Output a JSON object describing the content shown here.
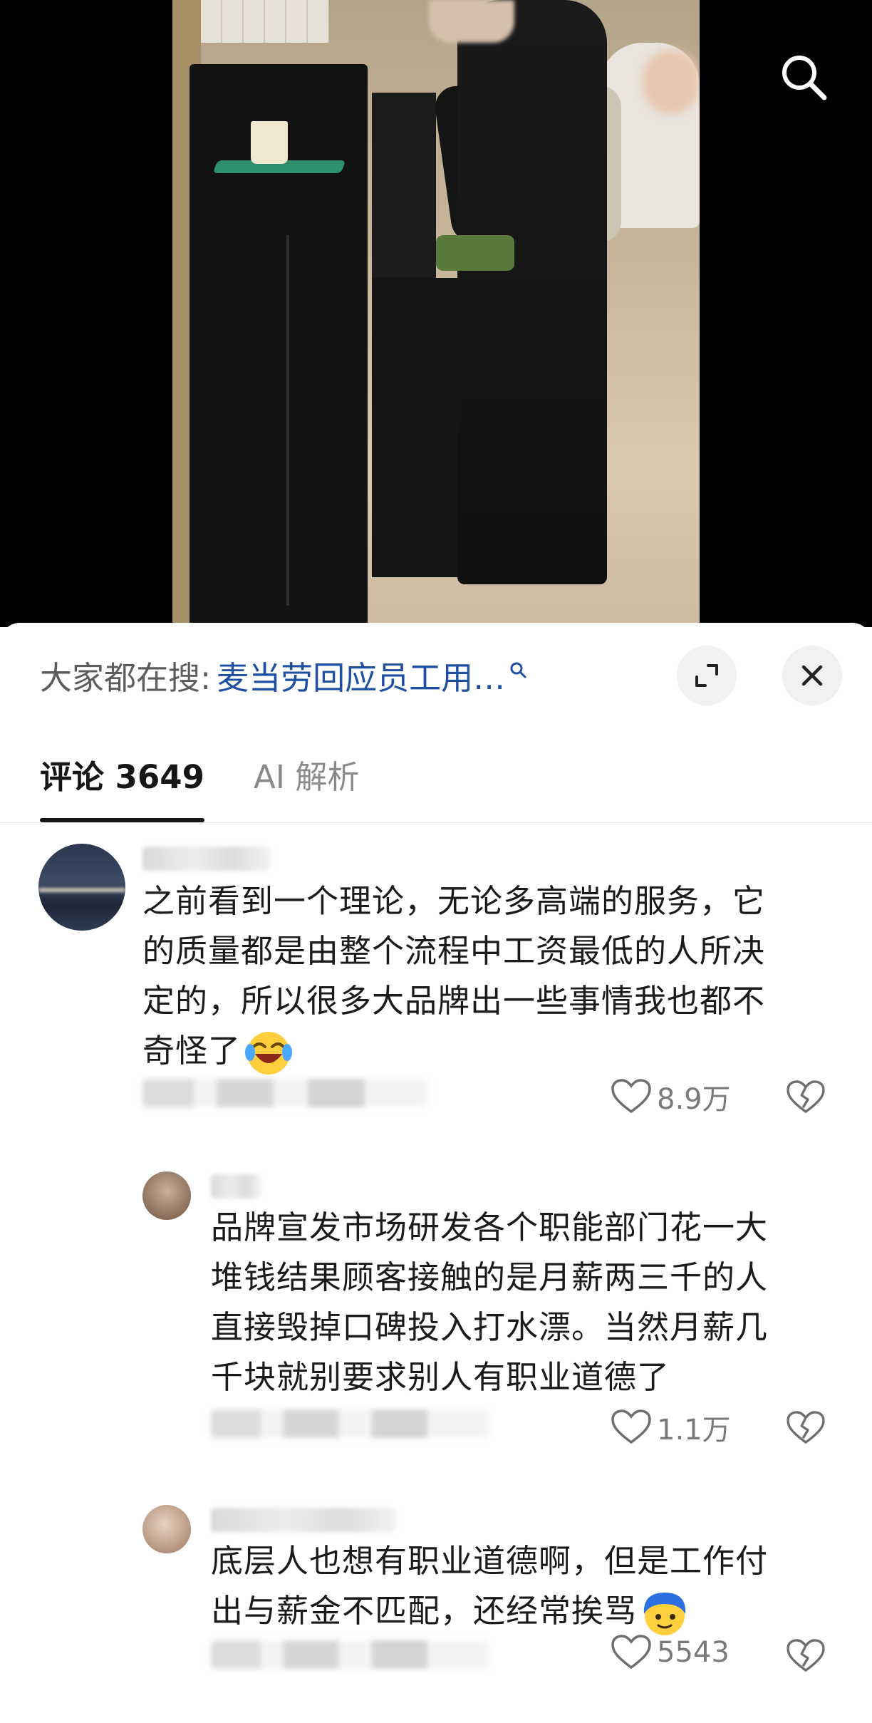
{
  "hot_search": {
    "prefix": "大家都在搜:",
    "query": "麦当劳回应员工用…"
  },
  "tabs": [
    {
      "label": "评论 3649",
      "active": true
    },
    {
      "label": "AI 解析",
      "active": false
    }
  ],
  "comments": [
    {
      "text_lines": [
        "之前看到一个理论，无论多高端的服务，它",
        "的质量都是由整个流程中工资最低的人所决",
        "定的，所以很多大品牌出一些事情我也都不",
        "奇怪了"
      ],
      "emoji": "laughing-crying-emoji",
      "likes": "8.9万"
    },
    {
      "text_lines": [
        "品牌宣发市场研发各个职能部门花一大",
        "堆钱结果顾客接触的是月薪两三千的人",
        "直接毁掉口碑投入打水漂。当然月薪几",
        "千块就别要求别人有职业道德了"
      ],
      "likes": "1.1万"
    },
    {
      "text_lines": [
        "底层人也想有职业道德啊，但是工作付",
        "出与薪金不匹配，还经常挨骂"
      ],
      "emoji": "blue-hair-face-emoji",
      "likes": "5543"
    }
  ],
  "icons": {
    "search": "search-icon",
    "expand": "expand-icon",
    "close": "close-icon",
    "like": "heart-icon",
    "dislike": "broken-heart-icon"
  },
  "colors": {
    "query_link": "#1f4fa3",
    "text": "#1b1b1b",
    "muted": "#7a7a7a"
  }
}
